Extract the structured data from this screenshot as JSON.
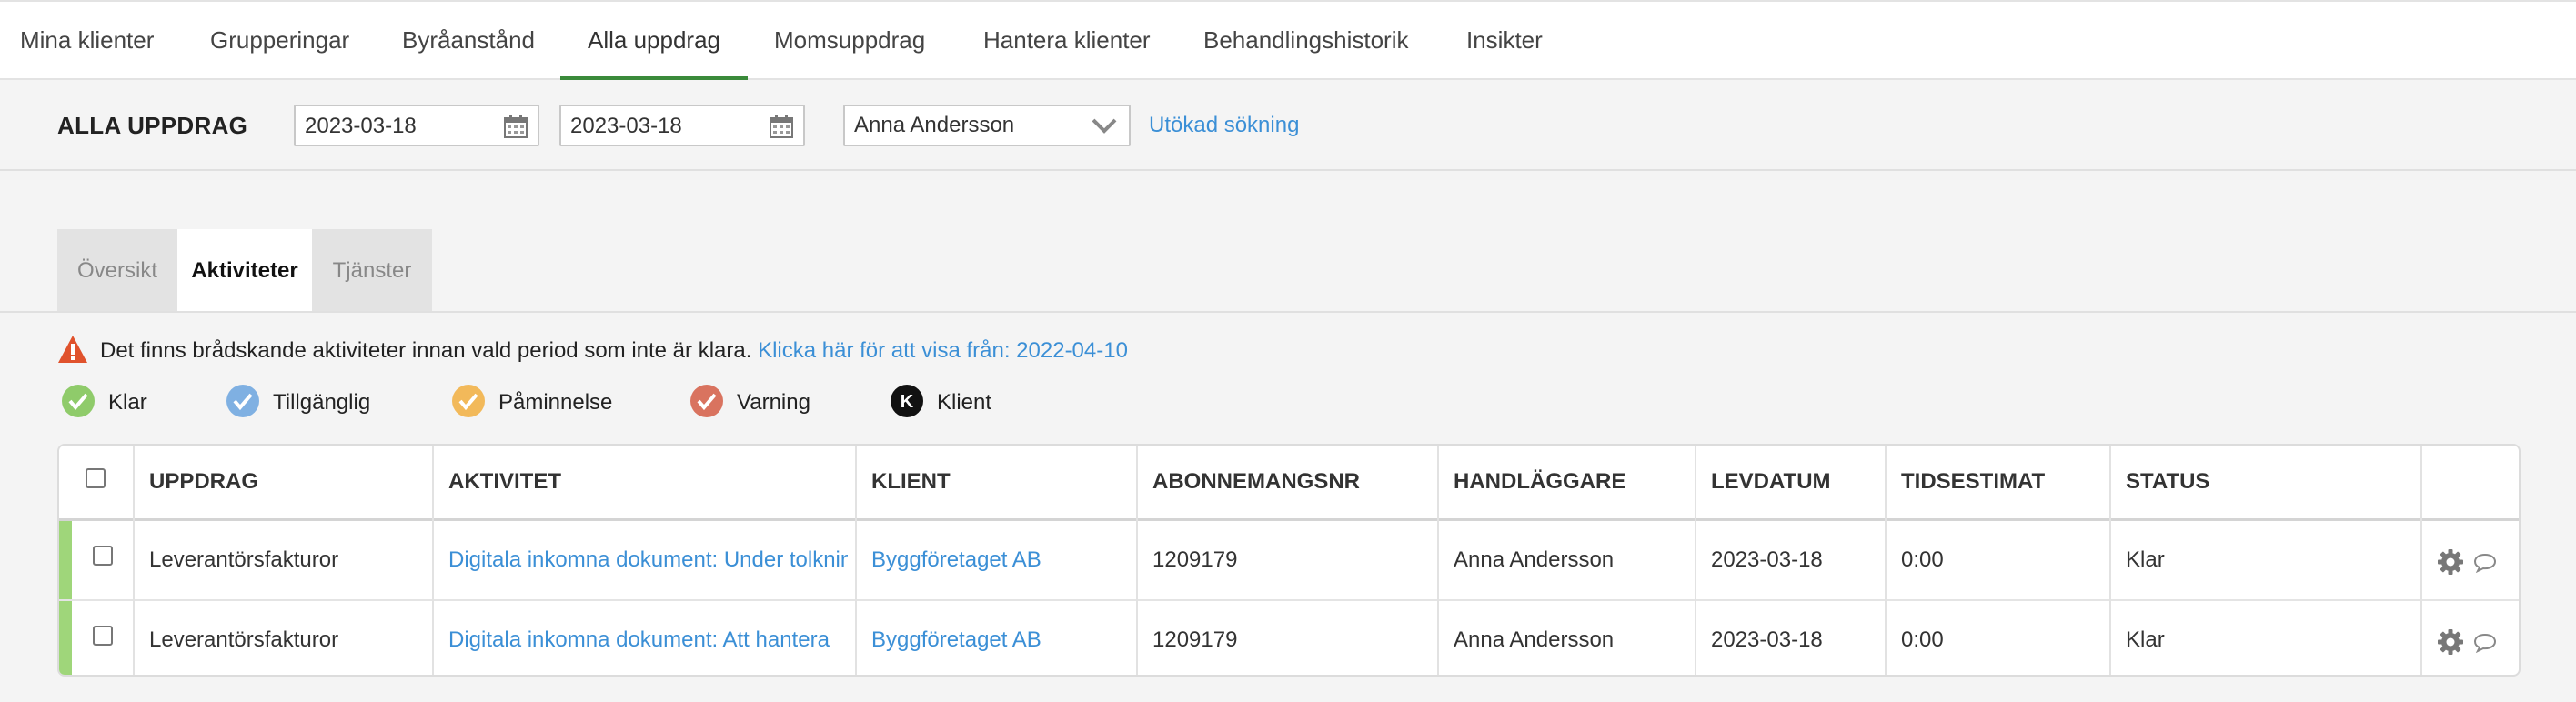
{
  "topnav": {
    "items": [
      {
        "label": "Mina klienter"
      },
      {
        "label": "Grupperingar"
      },
      {
        "label": "Byråanstånd"
      },
      {
        "label": "Alla uppdrag"
      },
      {
        "label": "Momsuppdrag"
      },
      {
        "label": "Hantera klienter"
      },
      {
        "label": "Behandlingshistorik"
      },
      {
        "label": "Insikter"
      }
    ],
    "active": "Alla uppdrag"
  },
  "filter": {
    "title": "ALLA UPPDRAG",
    "date_from": "2023-03-18",
    "date_to": "2023-03-18",
    "handler": "Anna Andersson",
    "advanced_search": "Utökad sökning"
  },
  "tabs": [
    {
      "label": "Översikt"
    },
    {
      "label": "Aktiviteter"
    },
    {
      "label": "Tjänster"
    }
  ],
  "alert": {
    "message": "Det finns brådskande aktiviteter innan vald period som inte är klara.",
    "link": "Klicka här för att visa från: 2022-04-10"
  },
  "legend": [
    {
      "label": "Klar",
      "color": "#8fcb6a"
    },
    {
      "label": "Tillgänglig",
      "color": "#7fb0e2"
    },
    {
      "label": "Påminnelse",
      "color": "#f2b95a"
    },
    {
      "label": "Varning",
      "color": "#d9735f"
    },
    {
      "label": "Klient",
      "icon_letter": "K",
      "color": "#111111"
    }
  ],
  "table": {
    "headers": [
      "UPPDRAG",
      "AKTIVITET",
      "KLIENT",
      "ABONNEMANGSNR",
      "HANDLÄGGARE",
      "LEVDATUM",
      "TIDSESTIMAT",
      "STATUS"
    ],
    "rows": [
      {
        "uppdrag": "Leverantörsfakturor",
        "aktivitet": "Digitala inkomna dokument: Under tolkning",
        "klient": "Byggföretaget AB",
        "abonnemangsnr": "1209179",
        "handlaggare": "Anna Andersson",
        "levdatum": "2023-03-18",
        "tidsestimat": "0:00",
        "status": "Klar"
      },
      {
        "uppdrag": "Leverantörsfakturor",
        "aktivitet": "Digitala inkomna dokument: Att hantera",
        "klient": "Byggföretaget AB",
        "abonnemangsnr": "1209179",
        "handlaggare": "Anna Andersson",
        "levdatum": "2023-03-18",
        "tidsestimat": "0:00",
        "status": "Klar"
      }
    ]
  }
}
